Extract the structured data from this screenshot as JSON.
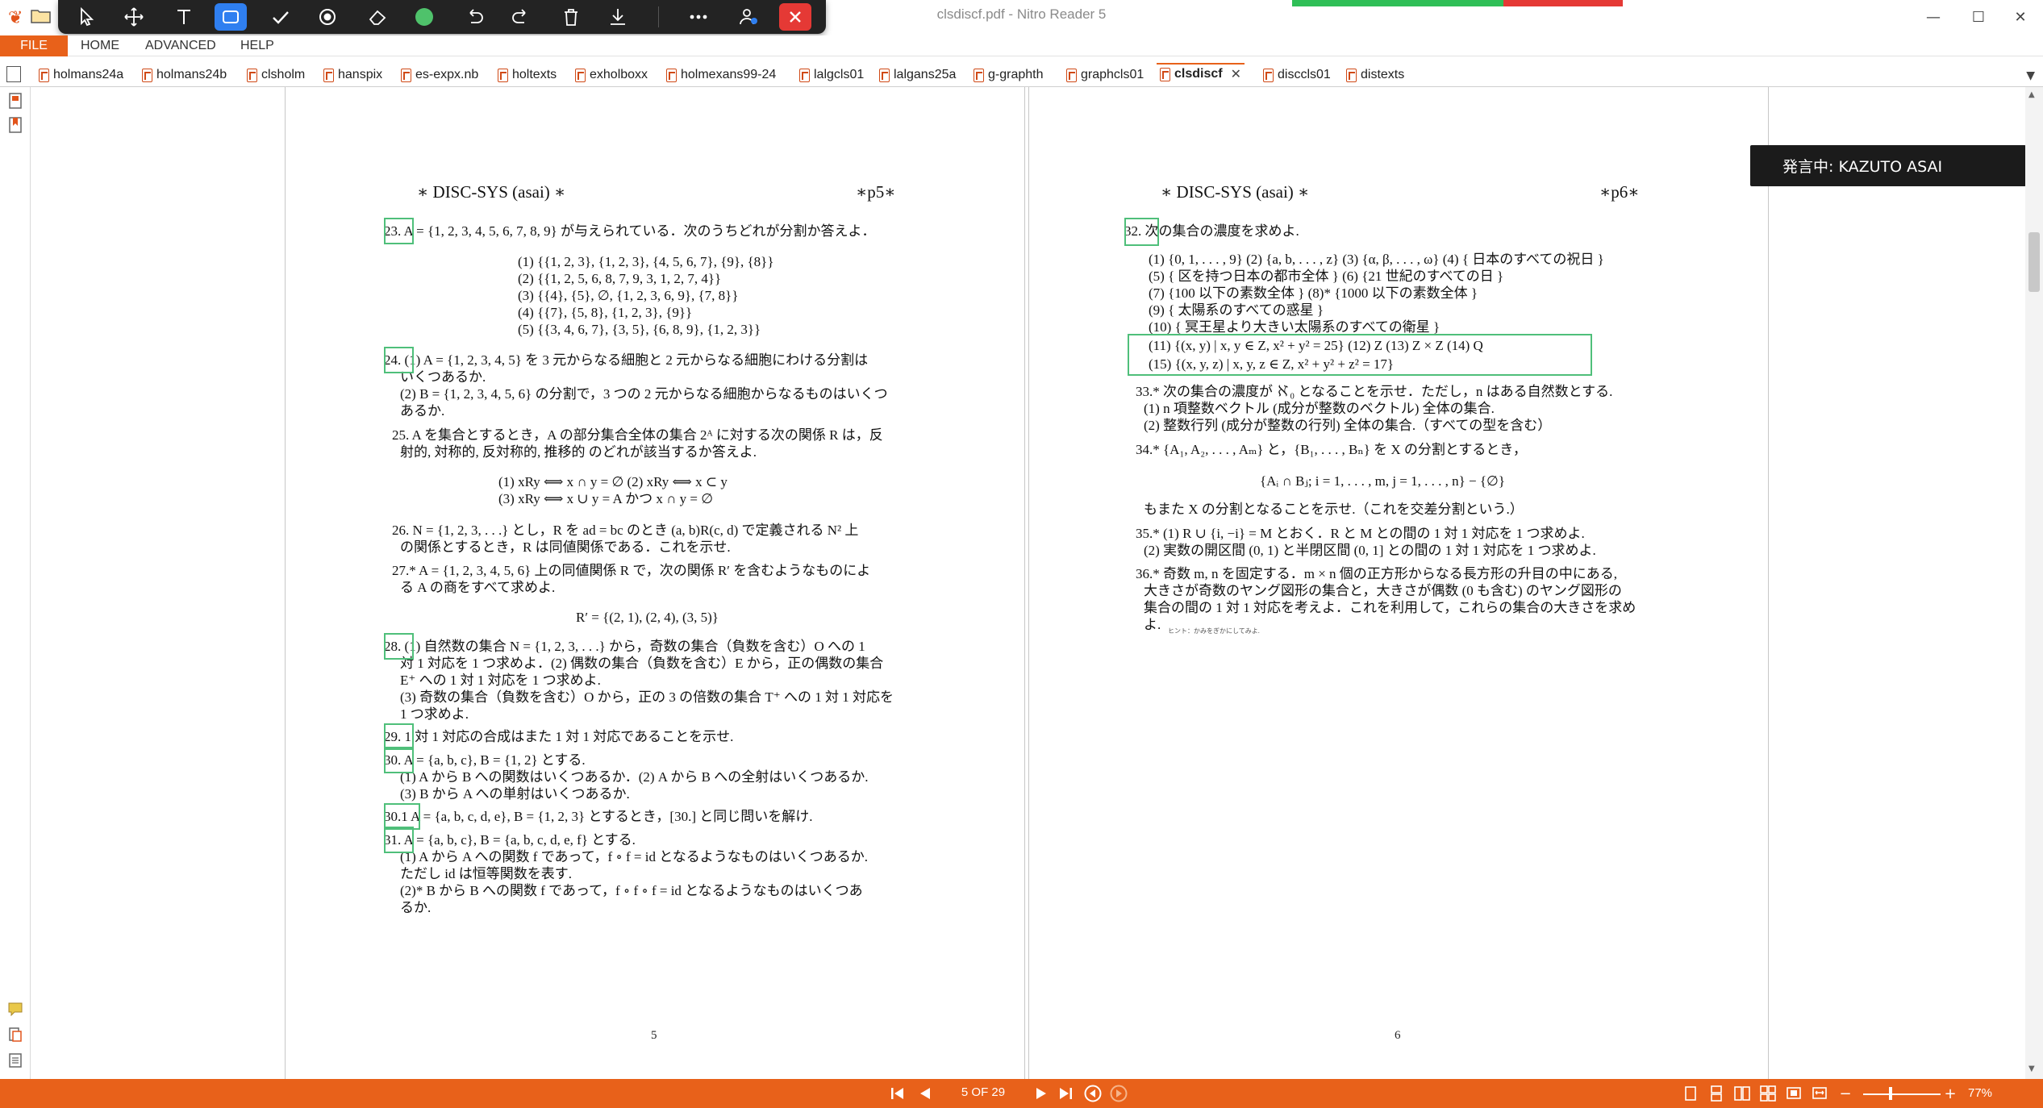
{
  "window": {
    "title": "clsdiscf.pdf - Nitro Reader 5",
    "minimize": "—",
    "maximize": "☐",
    "close": "✕"
  },
  "toolbar": {
    "tools": [
      "select",
      "pan",
      "type-text",
      "highlight-box",
      "check",
      "record",
      "eraser",
      "color",
      "undo",
      "redo",
      "delete",
      "download",
      "more",
      "users",
      "close"
    ],
    "active_tool": "highlight-box",
    "color_dot": "#4fc26b"
  },
  "menu": {
    "file": "FILE",
    "home": "HOME",
    "advanced": "ADVANCED",
    "help": "HELP"
  },
  "tabs": [
    {
      "label": "holmans24a"
    },
    {
      "label": "holmans24b"
    },
    {
      "label": "clsholm"
    },
    {
      "label": "hanspix"
    },
    {
      "label": "es-expx.nb"
    },
    {
      "label": "holtexts"
    },
    {
      "label": "exholboxx"
    },
    {
      "label": "holmexans99-24"
    },
    {
      "label": "lalgcls01"
    },
    {
      "label": "lalgans25a"
    },
    {
      "label": "g-graphth"
    },
    {
      "label": "graphcls01"
    },
    {
      "label": "clsdiscf"
    },
    {
      "label": "disccls01"
    },
    {
      "label": "distexts"
    }
  ],
  "active_tab": "clsdiscf",
  "notification": {
    "speaking": "発言中: KAZUTO ASAI"
  },
  "page_left": {
    "header_left": "∗ DISC-SYS (asai) ∗",
    "header_right": "∗p5∗",
    "lines": [
      "23. A = {1, 2, 3, 4, 5, 6, 7, 8, 9} が与えられている．次のうちどれが分割か答えよ．",
      "(1) {{1, 2, 3}, {1, 2, 3}, {4, 5, 6, 7}, {9}, {8}}",
      "(2) {{1, 2, 5, 6, 8, 7, 9, 3, 1, 2, 7, 4}}",
      "(3) {{4}, {5}, ∅, {1, 2, 3, 6, 9}, {7, 8}}",
      "(4) {{7}, {5, 8}, {1, 2, 3}, {9}}",
      "(5) {{3, 4, 6, 7}, {3, 5}, {6, 8, 9}, {1, 2, 3}}",
      "24. (1) A = {1, 2, 3, 4, 5} を 3 元からなる細胞と 2 元からなる細胞にわける分割は",
      "いくつあるか.",
      "(2) B = {1, 2, 3, 4, 5, 6} の分割で，3 つの 2 元からなる細胞からなるものはいくつ",
      "あるか.",
      "25. A を集合とするとき，A の部分集合全体の集合 2ᴬ に対する次の関係 R は，反",
      "射的, 対称的, 反対称的, 推移的 のどれが該当するか答えよ.",
      "(1) xRy ⟺ x ∩ y = ∅      (2) xRy ⟺ x ⊂ y",
      "(3) xRy ⟺ x ∪ y = A かつ x ∩ y = ∅",
      "26. N = {1, 2, 3, . . .} とし，R を ad = bc のとき (a, b)R(c, d) で定義される N² 上",
      "の関係とするとき，R は同値関係である．これを示せ.",
      "27.* A = {1, 2, 3, 4, 5, 6} 上の同値関係 R で，次の関係 R′ を含むようなものによ",
      "る A の商をすべて求めよ.",
      "R′ = {(2, 1), (2, 4), (3, 5)}",
      "28. (1) 自然数の集合 N = {1, 2, 3, . . .} から，奇数の集合（負数を含む）O への 1",
      "対 1 対応を 1 つ求めよ．(2) 偶数の集合（負数を含む）E から，正の偶数の集合",
      "E⁺ への 1 対 1 対応を 1 つ求めよ.",
      "(3) 奇数の集合（負数を含む）O から，正の 3 の倍数の集合 T⁺ への 1 対 1 対応を",
      "1 つ求めよ.",
      "29. 1 対 1 対応の合成はまた 1 対 1 対応であることを示せ.",
      "30. A = {a, b, c}, B = {1, 2} とする.",
      "(1) A から B への関数はいくつあるか．(2) A から B への全射はいくつあるか.",
      "(3) B から A への単射はいくつあるか.",
      "30.1 A = {a, b, c, d, e}, B = {1, 2, 3} とするとき，[30.] と同じ問いを解け.",
      "31. A = {a, b, c}, B = {a, b, c, d, e, f} とする.",
      "(1) A から A への関数 f であって，f ∘ f = id となるようなものはいくつあるか.",
      "ただし id は恒等関数を表す.",
      "(2)* B から B への関数 f であって，f ∘ f ∘ f = id となるようなものはいくつあ",
      "るか."
    ],
    "page_number": "5"
  },
  "page_right": {
    "header_left": "∗ DISC-SYS (asai) ∗",
    "header_right": "∗p6∗",
    "lines": [
      "32. 次の集合の濃度を求めよ.",
      "(1) {0, 1, . . . , 9} (2) {a, b, . . . , z} (3) {α, β, . . . , ω} (4) { 日本のすべての祝日 }",
      "(5) { 区を持つ日本の都市全体 }      (6) {21 世紀のすべての日 }",
      "(7) {100 以下の素数全体 }      (8)* {1000 以下の素数全体 }",
      "(9) { 太陽系のすべての惑星 }",
      "(10) { 冥王星より大きい太陽系のすべての衛星 }",
      "(11) {(x, y) | x, y ∈ Z, x² + y² = 25}   (12) Z   (13) Z × Z   (14) Q",
      "(15) {(x, y, z) | x, y, z ∈ Z, x² + y² + z² = 17}",
      "33.* 次の集合の濃度が ℵ₀ となることを示せ．ただし，n はある自然数とする.",
      "(1) n 項整数ベクトル (成分が整数のベクトル) 全体の集合.",
      "(2) 整数行列 (成分が整数の行列) 全体の集合.（すべての型を含む）",
      "34.* {A₁, A₂, . . . , Aₘ} と，{B₁, . . . , Bₙ} を X の分割とするとき，",
      "{Aᵢ ∩ Bⱼ; i = 1, . . . , m, j = 1, . . . , n} − {∅}",
      "もまた X の分割となることを示せ.（これを交差分割という.）",
      "35.* (1) R ∪ {i, −i} = M とおく．R と M との間の 1 対 1 対応を 1 つ求めよ.",
      "(2) 実数の開区間 (0, 1) と半閉区間 (0, 1] との間の 1 対 1 対応を 1 つ求めよ.",
      "36.* 奇数 m, n を固定する．m × n 個の正方形からなる長方形の升目の中にある,",
      "大きさが奇数のヤング図形の集合と，大きさが偶数 (0 も含む) のヤング図形の",
      "集合の間の 1 対 1 対応を考えよ．これを利用して，これらの集合の大きさを求め",
      "よ.",
      "ヒント：かみをぎかにしてみよ."
    ],
    "page_number": "6"
  },
  "status": {
    "page_indicator": "5 OF 29",
    "zoom": "77%",
    "zoom_level": 0.77
  }
}
